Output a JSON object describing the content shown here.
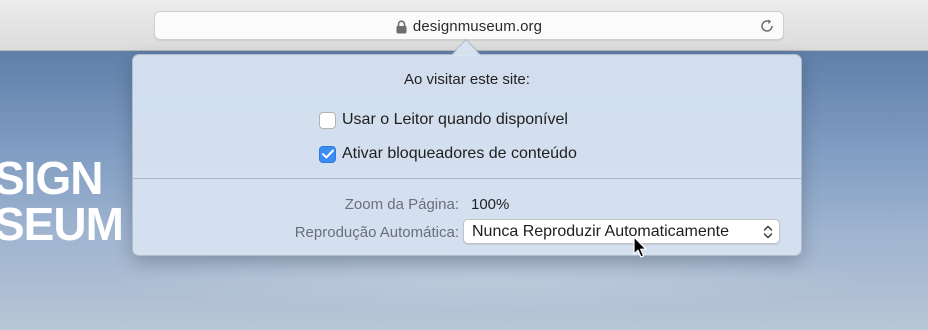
{
  "browser": {
    "url": "designmuseum.org"
  },
  "background": {
    "logo_lines": [
      "SIGN",
      "SEUM"
    ]
  },
  "popover": {
    "title": "Ao visitar este site:",
    "options": [
      {
        "label": "Usar o Leitor quando disponível",
        "checked": false
      },
      {
        "label": "Ativar bloqueadores de conteúdo",
        "checked": true
      }
    ],
    "zoom_label": "Zoom da Página:",
    "zoom_value": "100%",
    "autoplay_label": "Reprodução Automática:",
    "autoplay_value": "Nunca Reproduzir Automaticamente"
  },
  "colors": {
    "accent": "#3b8df4"
  }
}
